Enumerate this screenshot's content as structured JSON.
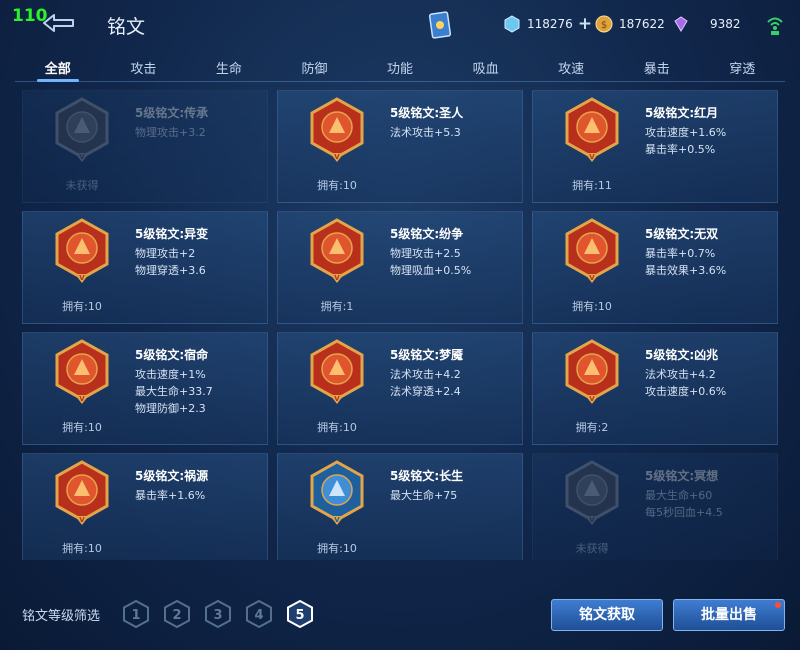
{
  "fps": "110",
  "header": {
    "title": "铭文"
  },
  "resources": {
    "coupon": {
      "icon": "coupon-icon",
      "value": "118276"
    },
    "gold": {
      "icon": "gold-coin-icon",
      "value": "187622"
    },
    "gem": {
      "icon": "gem-icon",
      "value": "9382"
    }
  },
  "tabs": [
    "全部",
    "攻击",
    "生命",
    "防御",
    "功能",
    "吸血",
    "攻速",
    "暴击",
    "穿透"
  ],
  "active_tab": 0,
  "cards": [
    {
      "name": "5级铭文:传承",
      "attrs": [
        "物理攻击+3.2"
      ],
      "owned": "未获得",
      "dim": true,
      "icon": "inscription-chuancheng-icon",
      "color": "gray"
    },
    {
      "name": "5级铭文:圣人",
      "attrs": [
        "法术攻击+5.3"
      ],
      "owned": "拥有:10",
      "dim": false,
      "icon": "inscription-shengren-icon",
      "color": "red"
    },
    {
      "name": "5级铭文:红月",
      "attrs": [
        "攻击速度+1.6%",
        "暴击率+0.5%"
      ],
      "owned": "拥有:11",
      "dim": false,
      "icon": "inscription-hongyue-icon",
      "color": "red"
    },
    {
      "name": "5级铭文:异变",
      "attrs": [
        "物理攻击+2",
        "物理穿透+3.6"
      ],
      "owned": "拥有:10",
      "dim": false,
      "icon": "inscription-yibian-icon",
      "color": "red"
    },
    {
      "name": "5级铭文:纷争",
      "attrs": [
        "物理攻击+2.5",
        "物理吸血+0.5%"
      ],
      "owned": "拥有:1",
      "dim": false,
      "icon": "inscription-fenzheng-icon",
      "color": "red"
    },
    {
      "name": "5级铭文:无双",
      "attrs": [
        "暴击率+0.7%",
        "暴击效果+3.6%"
      ],
      "owned": "拥有:10",
      "dim": false,
      "icon": "inscription-wushuang-icon",
      "color": "red"
    },
    {
      "name": "5级铭文:宿命",
      "attrs": [
        "攻击速度+1%",
        "最大生命+33.7",
        "物理防御+2.3"
      ],
      "owned": "拥有:10",
      "dim": false,
      "icon": "inscription-suming-icon",
      "color": "red"
    },
    {
      "name": "5级铭文:梦魇",
      "attrs": [
        "法术攻击+4.2",
        "法术穿透+2.4"
      ],
      "owned": "拥有:10",
      "dim": false,
      "icon": "inscription-mengyan-icon",
      "color": "red"
    },
    {
      "name": "5级铭文:凶兆",
      "attrs": [
        "法术攻击+4.2",
        "攻击速度+0.6%"
      ],
      "owned": "拥有:2",
      "dim": false,
      "icon": "inscription-xiongzhao-icon",
      "color": "red"
    },
    {
      "name": "5级铭文:祸源",
      "attrs": [
        "暴击率+1.6%"
      ],
      "owned": "拥有:10",
      "dim": false,
      "icon": "inscription-huoyuan-icon",
      "color": "red"
    },
    {
      "name": "5级铭文:长生",
      "attrs": [
        "最大生命+75"
      ],
      "owned": "拥有:10",
      "dim": false,
      "icon": "inscription-changsheng-icon",
      "color": "blue"
    },
    {
      "name": "5级铭文:冥想",
      "attrs": [
        "最大生命+60",
        "每5秒回血+4.5"
      ],
      "owned": "未获得",
      "dim": true,
      "icon": "inscription-mingxiang-icon",
      "color": "gray"
    }
  ],
  "footer": {
    "filter_label": "铭文等级筛选",
    "levels": [
      "1",
      "2",
      "3",
      "4",
      "5"
    ],
    "active_level": 4,
    "get_button": "铭文获取",
    "sell_button": "批量出售"
  },
  "badge_mark": "V",
  "colors": {
    "accent": "#6fb7ff",
    "red_badge": "#c8321c",
    "blue_badge": "#1e5f9e",
    "gold_frame": "#e2a54a"
  }
}
